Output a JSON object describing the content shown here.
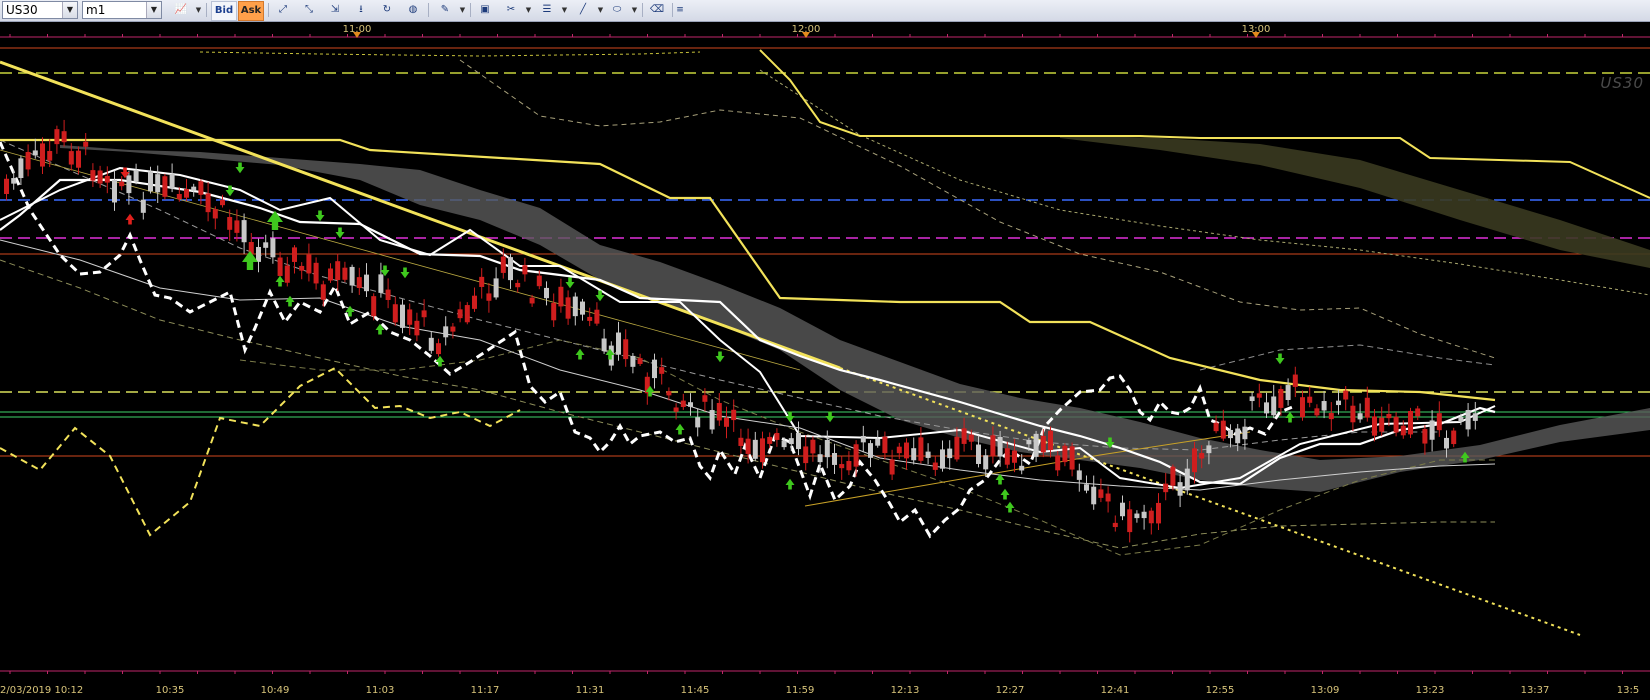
{
  "toolbar": {
    "symbol": "US30",
    "timeframe": "m1",
    "bid_label": "Bid",
    "ask_label": "Ask",
    "icons": [
      "chart-type-icon",
      "bid-icon",
      "ask-icon",
      "zoom-in-icon",
      "zoom-out-icon",
      "fit-icon",
      "refresh-icon",
      "globe-icon",
      "pencil-icon",
      "screenshot-icon",
      "tools-icon",
      "indicators-icon",
      "line-tool-icon",
      "shape-tool-icon",
      "eraser-icon",
      "collapse-icon"
    ]
  },
  "axis": {
    "top_ticks": [
      "11:00",
      "12:00",
      "13:00"
    ],
    "bottom_ticks": [
      "2/03/2019 10:12",
      "10:35",
      "10:49",
      "11:03",
      "11:17",
      "11:31",
      "11:45",
      "11:59",
      "12:13",
      "12:27",
      "12:41",
      "12:55",
      "13:09",
      "13:23",
      "13:37",
      "13:5"
    ]
  },
  "chart": {
    "watermark": "US30"
  },
  "colors": {
    "bull": "#c8c8c8",
    "bear": "#d01e1e",
    "tenkan": "#ffffff",
    "kijun": "#f2e25a",
    "cloud": "#5a5a5a",
    "ref_blue": "#3b6cff",
    "ref_magenta": "#e031d9",
    "ref_green": "#3fd36a"
  }
}
